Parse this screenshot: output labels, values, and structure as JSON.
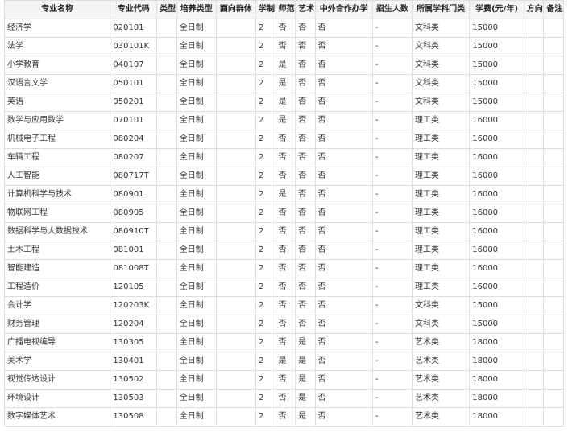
{
  "table": {
    "headers": [
      "专业名称",
      "专业代码",
      "类型",
      "培养类型",
      "面向群体",
      "学制",
      "师范",
      "艺术",
      "中外合作办学",
      "招生人数",
      "所属学科门类",
      "学费(元/年)",
      "方向",
      "备注"
    ],
    "rows": [
      [
        "经济学",
        "020101",
        "",
        "全日制",
        "",
        "2",
        "否",
        "否",
        "否",
        "-",
        "文科类",
        "15000",
        "",
        ""
      ],
      [
        "法学",
        "030101K",
        "",
        "全日制",
        "",
        "2",
        "否",
        "否",
        "否",
        "-",
        "文科类",
        "15000",
        "",
        ""
      ],
      [
        "小学教育",
        "040107",
        "",
        "全日制",
        "",
        "2",
        "是",
        "否",
        "否",
        "-",
        "文科类",
        "15000",
        "",
        ""
      ],
      [
        "汉语言文学",
        "050101",
        "",
        "全日制",
        "",
        "2",
        "是",
        "否",
        "否",
        "-",
        "文科类",
        "15000",
        "",
        ""
      ],
      [
        "英语",
        "050201",
        "",
        "全日制",
        "",
        "2",
        "是",
        "否",
        "否",
        "-",
        "文科类",
        "15000",
        "",
        ""
      ],
      [
        "数学与应用数学",
        "070101",
        "",
        "全日制",
        "",
        "2",
        "是",
        "否",
        "否",
        "-",
        "理工类",
        "16000",
        "",
        ""
      ],
      [
        "机械电子工程",
        "080204",
        "",
        "全日制",
        "",
        "2",
        "否",
        "否",
        "否",
        "-",
        "理工类",
        "16000",
        "",
        ""
      ],
      [
        "车辆工程",
        "080207",
        "",
        "全日制",
        "",
        "2",
        "否",
        "否",
        "否",
        "-",
        "理工类",
        "16000",
        "",
        ""
      ],
      [
        "人工智能",
        "080717T",
        "",
        "全日制",
        "",
        "2",
        "否",
        "否",
        "否",
        "-",
        "理工类",
        "16000",
        "",
        ""
      ],
      [
        "计算机科学与技术",
        "080901",
        "",
        "全日制",
        "",
        "2",
        "是",
        "否",
        "否",
        "-",
        "理工类",
        "16000",
        "",
        ""
      ],
      [
        "物联网工程",
        "080905",
        "",
        "全日制",
        "",
        "2",
        "否",
        "否",
        "否",
        "-",
        "理工类",
        "16000",
        "",
        ""
      ],
      [
        "数据科学与大数据技术",
        "080910T",
        "",
        "全日制",
        "",
        "2",
        "否",
        "否",
        "否",
        "-",
        "理工类",
        "16000",
        "",
        ""
      ],
      [
        "土木工程",
        "081001",
        "",
        "全日制",
        "",
        "2",
        "否",
        "否",
        "否",
        "-",
        "理工类",
        "16000",
        "",
        ""
      ],
      [
        "智能建造",
        "081008T",
        "",
        "全日制",
        "",
        "2",
        "否",
        "否",
        "否",
        "-",
        "理工类",
        "16000",
        "",
        ""
      ],
      [
        "工程造价",
        "120105",
        "",
        "全日制",
        "",
        "2",
        "否",
        "否",
        "否",
        "-",
        "理工类",
        "16000",
        "",
        ""
      ],
      [
        "会计学",
        "120203K",
        "",
        "全日制",
        "",
        "2",
        "否",
        "否",
        "否",
        "-",
        "文科类",
        "15000",
        "",
        ""
      ],
      [
        "财务管理",
        "120204",
        "",
        "全日制",
        "",
        "2",
        "否",
        "否",
        "否",
        "-",
        "文科类",
        "15000",
        "",
        ""
      ],
      [
        "广播电视编导",
        "130305",
        "",
        "全日制",
        "",
        "2",
        "否",
        "是",
        "否",
        "-",
        "艺术类",
        "18000",
        "",
        ""
      ],
      [
        "美术学",
        "130401",
        "",
        "全日制",
        "",
        "2",
        "是",
        "是",
        "否",
        "-",
        "艺术类",
        "18000",
        "",
        ""
      ],
      [
        "视觉传达设计",
        "130502",
        "",
        "全日制",
        "",
        "2",
        "否",
        "是",
        "否",
        "-",
        "艺术类",
        "18000",
        "",
        ""
      ],
      [
        "环境设计",
        "130503",
        "",
        "全日制",
        "",
        "2",
        "否",
        "是",
        "否",
        "-",
        "艺术类",
        "18000",
        "",
        ""
      ],
      [
        "数字媒体艺术",
        "130508",
        "",
        "全日制",
        "",
        "2",
        "否",
        "是",
        "否",
        "-",
        "艺术类",
        "18000",
        "",
        ""
      ]
    ]
  }
}
